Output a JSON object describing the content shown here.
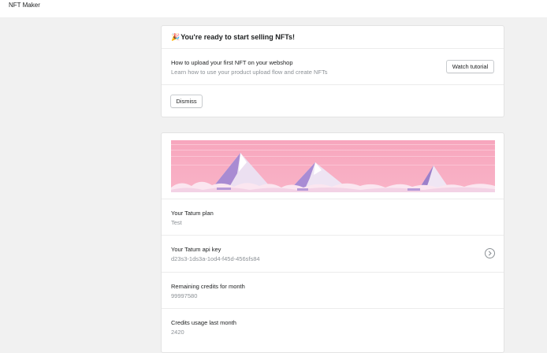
{
  "app": {
    "title": "NFT Maker"
  },
  "banner": {
    "emoji": "🎉",
    "title": "You're ready to start selling NFTs!",
    "tutorial_title": "How to upload your first NFT on your webshop",
    "tutorial_subtitle": "Learn how to use your product upload flow and create NFTs",
    "watch_label": "Watch tutorial",
    "dismiss_label": "Dismiss"
  },
  "settings": {
    "rows": [
      {
        "label": "Your Tatum plan",
        "value": "Test"
      },
      {
        "label": "Your Tatum api key",
        "value": "d23s3-1ds3a-1od4-f45d-456sfs84"
      },
      {
        "label": "Remaining credits for month",
        "value": "99997580"
      },
      {
        "label": "Credits usage last month",
        "value": "2420"
      }
    ]
  },
  "colors": {
    "sky": "#f8a8c0",
    "mountain_light": "#f4eaf4",
    "mountain_shadow": "#9a80c8",
    "snow_base": "#fbe6f0"
  },
  "icons": {
    "api_key_action": "chevron-right-circle-icon"
  }
}
